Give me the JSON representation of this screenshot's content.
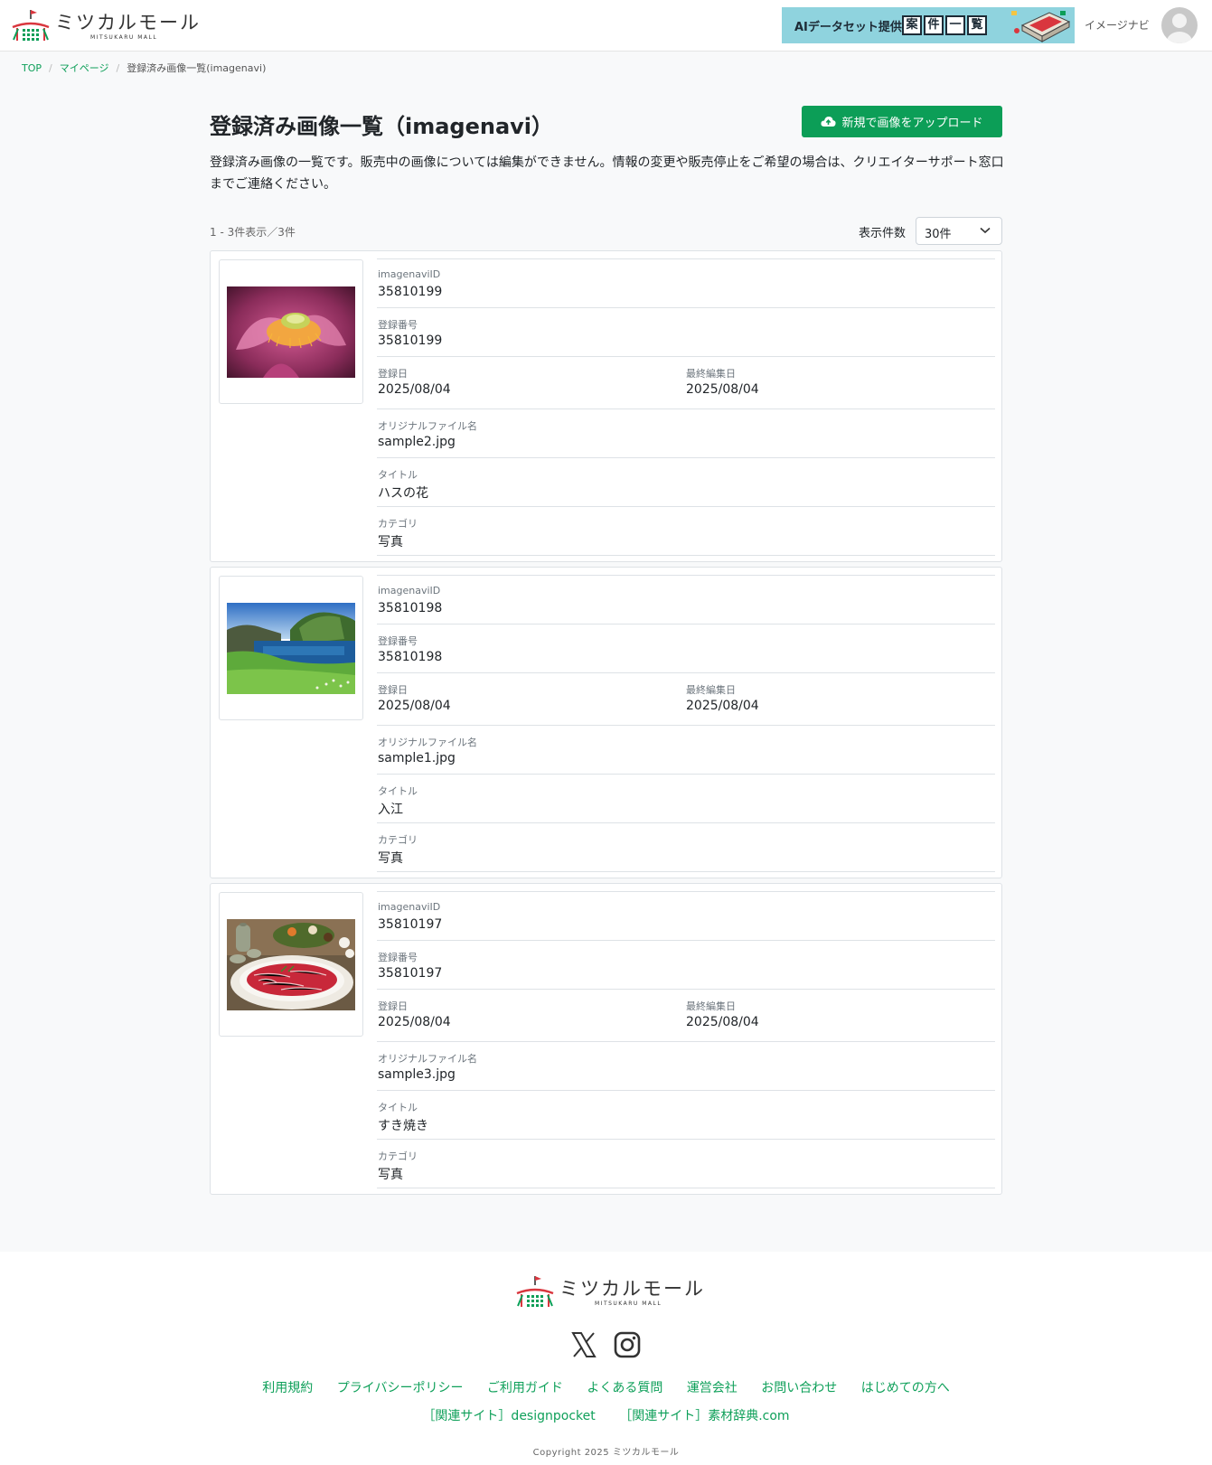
{
  "header": {
    "logo_text": "ミツカルモール",
    "logo_sub": "MITSUKARU MALL",
    "banner": {
      "text": "AIデータセット提供",
      "boxes": [
        "案",
        "件",
        "一",
        "覧"
      ],
      "background": "#8fd3de"
    },
    "user_name": "イメージナビ"
  },
  "breadcrumb": {
    "items": [
      "TOP",
      "マイページ"
    ],
    "current": "登録済み画像一覧(imagenavi)"
  },
  "main": {
    "title": "登録済み画像一覧（imagenavi）",
    "upload_button": "新規で画像をアップロード",
    "intro": "登録済み画像の一覧です。販売中の画像については編集ができません。情報の変更や販売停止をご希望の場合は、クリエイターサポート窓口までご連絡ください。",
    "count": "1 - 3件表示／3件",
    "per_page_label": "表示件数",
    "per_page_value": "30件"
  },
  "labels": {
    "imagenavi_id": "imagenaviID",
    "reg_number": "登録番号",
    "reg_date": "登録日",
    "last_edit": "最終編集日",
    "filename": "オリジナルファイル名",
    "title": "タイトル",
    "category": "カテゴリ"
  },
  "items": [
    {
      "thumbnail": "lotus-flower-photo",
      "imagenavi_id": "35810199",
      "reg_number": "35810199",
      "reg_date": "2025/08/04",
      "last_edit": "2025/08/04",
      "filename": "sample2.jpg",
      "title": "ハスの花",
      "category": "写真"
    },
    {
      "thumbnail": "coastal-inlet-photo",
      "imagenavi_id": "35810198",
      "reg_number": "35810198",
      "reg_date": "2025/08/04",
      "last_edit": "2025/08/04",
      "filename": "sample1.jpg",
      "title": "入江",
      "category": "写真"
    },
    {
      "thumbnail": "sukiyaki-photo",
      "imagenavi_id": "35810197",
      "reg_number": "35810197",
      "reg_date": "2025/08/04",
      "last_edit": "2025/08/04",
      "filename": "sample3.jpg",
      "title": "すき焼き",
      "category": "写真"
    }
  ],
  "footer": {
    "logo_text": "ミツカルモール",
    "logo_sub": "MITSUKARU MALL",
    "social": [
      "x-icon",
      "instagram-icon"
    ],
    "links": [
      "利用規約",
      "プライバシーポリシー",
      "ご利用ガイド",
      "よくある質問",
      "運営会社",
      "お問い合わせ",
      "はじめての方へ"
    ],
    "related_links": [
      "［関連サイト］designpocket",
      "［関連サイト］素材辞典.com"
    ],
    "copyright": "Copyright 2025 ミツカルモール"
  },
  "colors": {
    "accent": "#0c9e57",
    "link": "#0fa05a"
  }
}
